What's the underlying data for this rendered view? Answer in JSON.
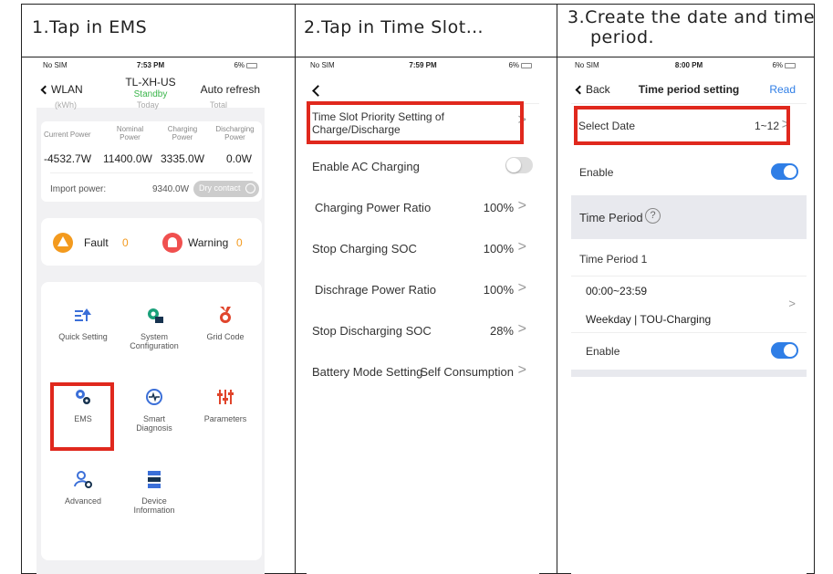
{
  "headers": [
    "1.Tap in EMS",
    "2.Tap in Time Slot…",
    "3.Create the date and time",
    "period."
  ],
  "status": {
    "carrier": "No SIM",
    "battery": "6%",
    "times": [
      "7:53 PM",
      "7:59 PM",
      "8:00 PM"
    ]
  },
  "panel1": {
    "back": "WLAN",
    "title": "TL-XH-US",
    "state": "Standby",
    "refresh": "Auto refresh",
    "faded": [
      "(kWh)",
      "Today",
      "Total"
    ],
    "stat_labels": [
      "Current Power",
      "Nominal Power",
      "Charging Power",
      "Discharging Power"
    ],
    "stat_values": [
      "-4532.7W",
      "11400.0W",
      "3335.0W",
      "0.0W"
    ],
    "import_label": "Import power:",
    "import_value": "9340.0W",
    "dry_contact": "Dry contact",
    "fault_label": "Fault",
    "fault_count": "0",
    "warning_label": "Warning",
    "warning_count": "0",
    "menu": [
      {
        "label": "Quick Setting",
        "icon": "quick-setting-icon"
      },
      {
        "label": "System Configuration",
        "icon": "system-configuration-icon"
      },
      {
        "label": "Grid Code",
        "icon": "grid-code-icon"
      },
      {
        "label": "EMS",
        "icon": "ems-icon"
      },
      {
        "label": "Smart Diagnosis",
        "icon": "smart-diagnosis-icon"
      },
      {
        "label": "Parameters",
        "icon": "parameters-icon"
      },
      {
        "label": "Advanced",
        "icon": "advanced-icon"
      },
      {
        "label": "Device Information",
        "icon": "device-information-icon"
      }
    ]
  },
  "panel2": {
    "items": [
      {
        "label": "Time Slot Priority Setting of Charge/Discharge",
        "value": ""
      },
      {
        "label": "Enable AC Charging",
        "value": ""
      },
      {
        "label": "Charging Power Ratio",
        "value": "100%"
      },
      {
        "label": "Stop Charging SOC",
        "value": "100%"
      },
      {
        "label": "Dischrage Power Ratio",
        "value": "100%"
      },
      {
        "label": "Stop Discharging SOC",
        "value": "28%"
      },
      {
        "label": "Battery Mode Setting",
        "value": "Self Consumption"
      }
    ]
  },
  "panel3": {
    "back": "Back",
    "title": "Time period setting",
    "read": "Read",
    "select_date": "Select Date",
    "date_value": "1~12",
    "enable": "Enable",
    "time_period": "Time Period",
    "period_name": "Time Period 1",
    "period_time": "00:00~23:59",
    "period_mode": "Weekday | TOU-Charging",
    "period_enable": "Enable"
  },
  "colors": {
    "accent": "#2f7ee6",
    "highlight": "#e0281d",
    "standby": "#3ab54a",
    "fault": "#f39a1e",
    "warning": "#f0504f"
  }
}
